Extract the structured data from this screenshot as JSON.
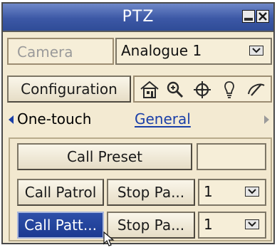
{
  "window": {
    "title": "PTZ"
  },
  "camera": {
    "label": "Camera",
    "value": "Analogue 1"
  },
  "toolbar": {
    "configuration_label": "Configuration",
    "icons": [
      "home-icon",
      "zoom-icon",
      "crosshair-icon",
      "light-bulb-icon",
      "wiper-icon"
    ]
  },
  "tabs": {
    "one_touch": "One-touch",
    "general": "General"
  },
  "preset": {
    "call_label": "Call Preset",
    "value": ""
  },
  "patrol": {
    "call_label": "Call Patrol",
    "stop_label": "Stop Pa...",
    "value": "1"
  },
  "pattern": {
    "call_label": "Call Patt...",
    "stop_label": "Stop Pa...",
    "value": "1"
  },
  "colors": {
    "title_bar": "#3c58a6",
    "window_bg": "#f3ead2",
    "active_button": "#1c3a91",
    "link_text": "#1a3fa8"
  }
}
